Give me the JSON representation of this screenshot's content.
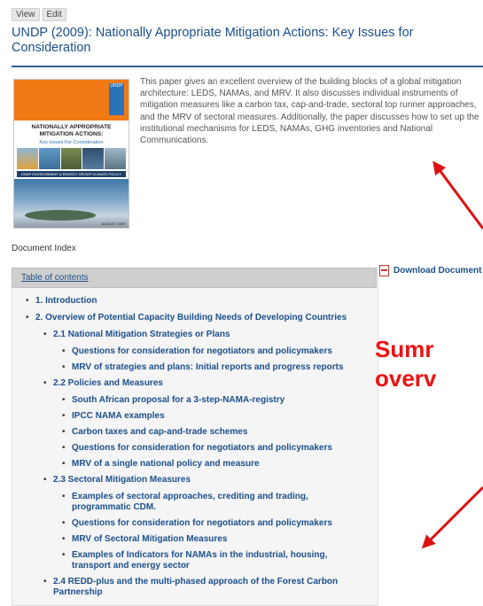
{
  "tabs": {
    "view": "View",
    "edit": "Edit"
  },
  "title": "UNDP (2009): Nationally Appropriate Mitigation Actions: Key Issues for Consideration",
  "cover": {
    "logo": "UNDP",
    "title": "NATIONALLY APPROPRIATE MITIGATION ACTIONS:",
    "subtitle": "Key Issues For Consideration",
    "series": "UNDP ENVIRONMENT & ENERGY GROUP CLIMATE POLICY SERIES",
    "date": "AUGUST 2009"
  },
  "summary": "This paper gives an excellent overview of the building blocks of a global mitigation architecture: LEDS, NAMAs, and MRV. It also discusses individual instruments of mitigation measures like a carbon tax, cap-and-trade, sectoral top runner approaches, and the MRV of sectoral measures. Additionally, the paper discusses how to set up the institutional mechanisms for LEDS, NAMAs, GHG inventories and National Communications.",
  "document_index_label": "Document Index",
  "toc": {
    "heading": "Table of contents",
    "items": [
      {
        "text": "1. Introduction",
        "level": 0
      },
      {
        "text": "2. Overview of Potential Capacity Building Needs of Developing Countries",
        "level": 0
      },
      {
        "text": "2.1 National Mitigation Strategies or Plans",
        "level": 1
      },
      {
        "text": "Questions for consideration for negotiators and policymakers",
        "level": 2
      },
      {
        "text": "MRV of strategies and plans: Initial reports and progress reports",
        "level": 2
      },
      {
        "text": "2.2 Policies and Measures",
        "level": 1
      },
      {
        "text": "South African proposal for a 3-step-NAMA-registry",
        "level": 2
      },
      {
        "text": "IPCC NAMA examples",
        "level": 2
      },
      {
        "text": "Carbon taxes and cap-and-trade schemes",
        "level": 2
      },
      {
        "text": "Questions for consideration for negotiators and policymakers",
        "level": 2
      },
      {
        "text": "MRV of a single national policy and measure",
        "level": 2
      },
      {
        "text": "2.3 Sectoral Mitigation Measures",
        "level": 1
      },
      {
        "text": "Examples of sectoral approaches, crediting and trading, programmatic CDM.",
        "level": 2
      },
      {
        "text": "Questions for consideration for negotiators and policymakers",
        "level": 2
      },
      {
        "text": "MRV of Sectoral Mitigation Measures",
        "level": 2
      },
      {
        "text": "Examples of Indicators for NAMAs in the industrial, housing, transport and energy sector",
        "level": 2
      },
      {
        "text": "2.4 REDD-plus and the multi-phased approach of the Forest Carbon Partnership",
        "level": 1
      }
    ]
  },
  "download_label": "Download Document",
  "overlay": {
    "line1": "Sumr",
    "line2": "overv"
  },
  "colors": {
    "link": "#1b4f8c",
    "overlay": "#ee1111",
    "cover_orange": "#f07a16"
  }
}
